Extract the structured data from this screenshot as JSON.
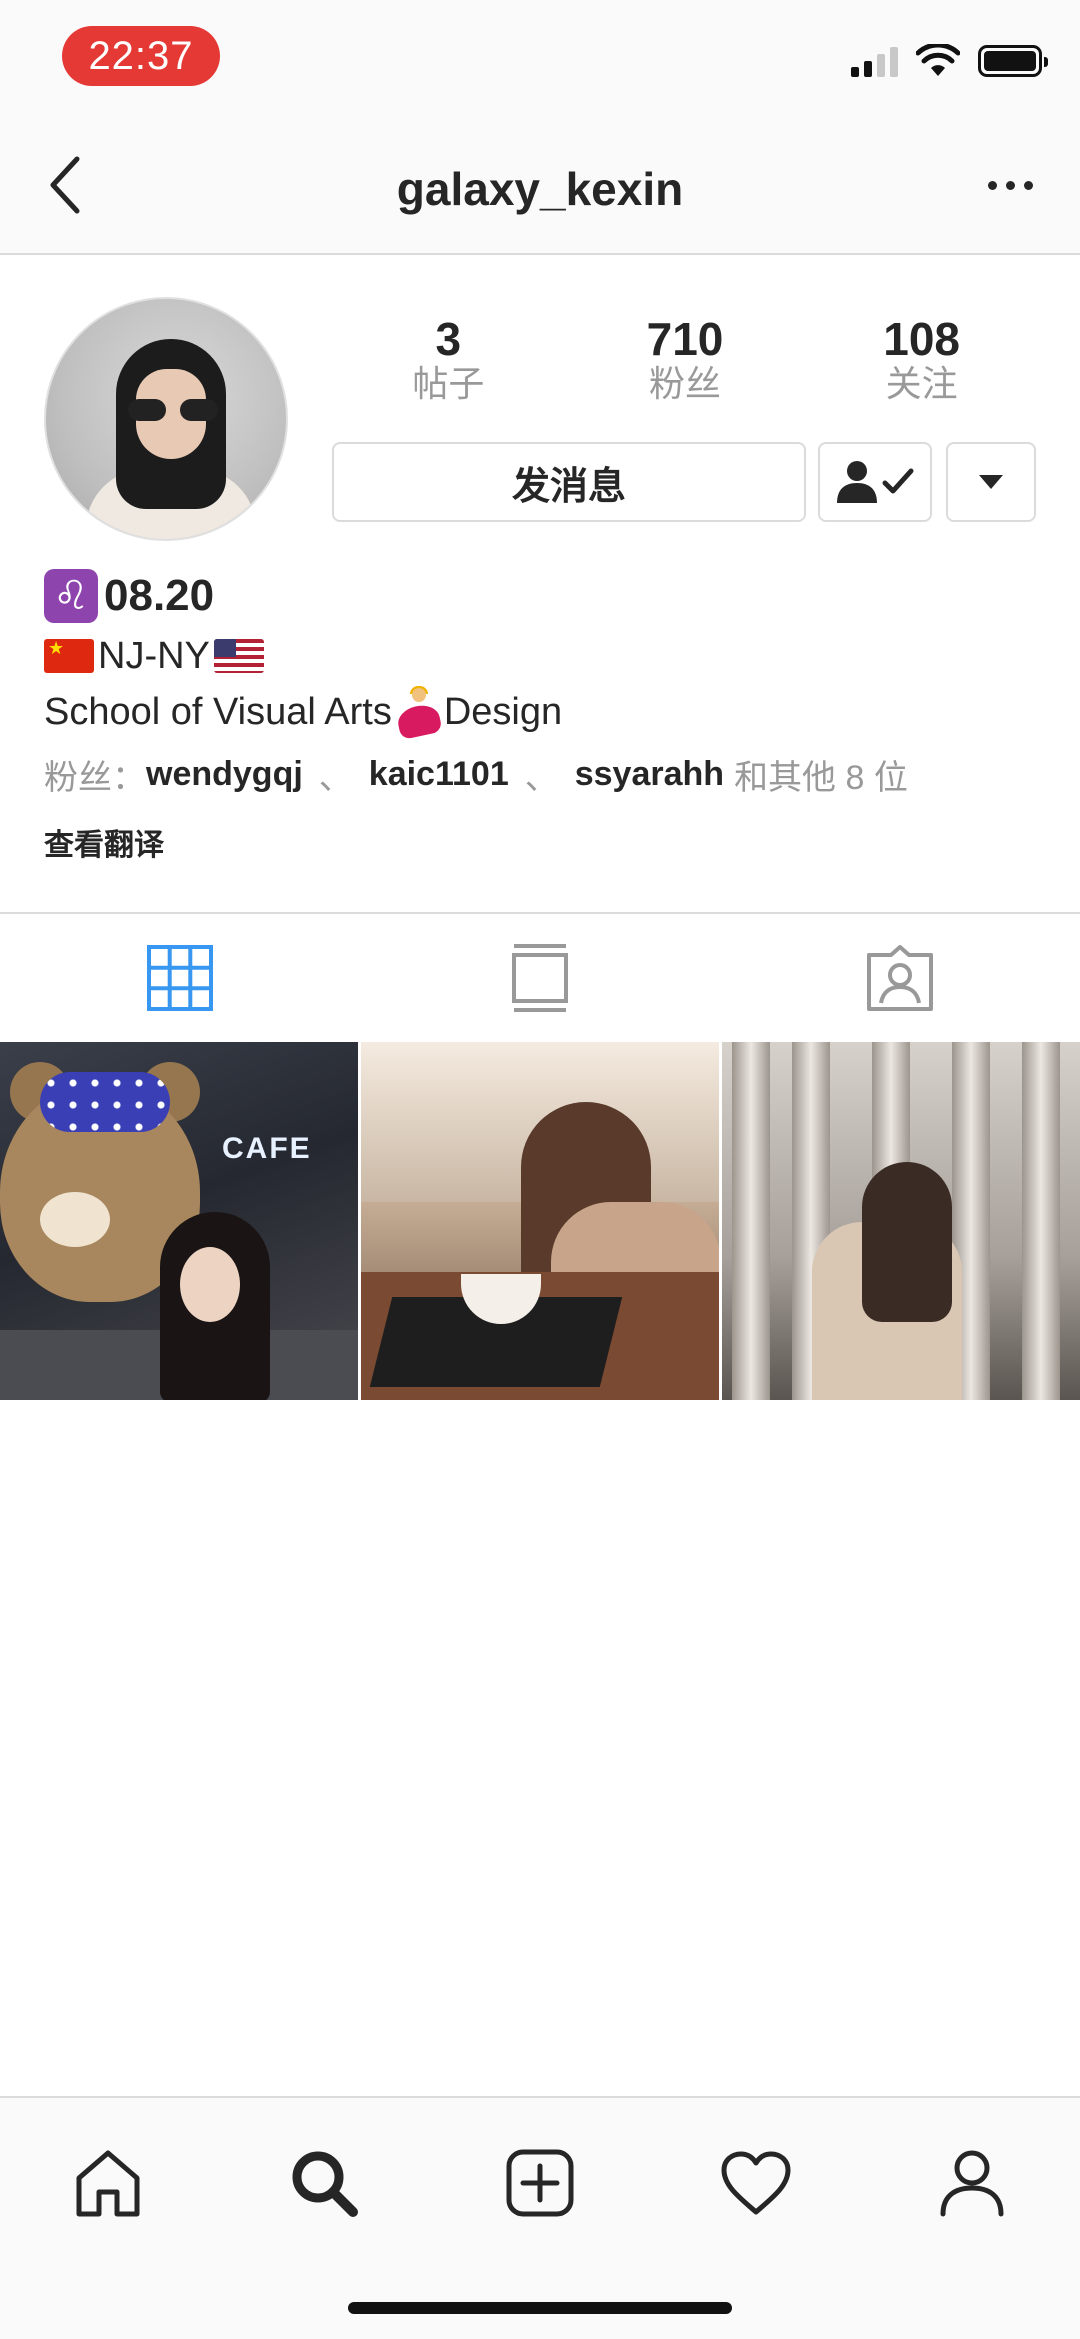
{
  "status_bar": {
    "time": "22:37"
  },
  "header": {
    "username": "galaxy_kexin"
  },
  "profile": {
    "stats": [
      {
        "value": "3",
        "label": "帖子"
      },
      {
        "value": "710",
        "label": "粉丝"
      },
      {
        "value": "108",
        "label": "关注"
      }
    ],
    "message_button": "发消息"
  },
  "bio": {
    "line1_text": "08.20",
    "line2_text": "NJ-NY",
    "line3_before": "School of Visual Arts",
    "line3_after": "Design",
    "followers_prefix": "粉丝：",
    "followers": [
      "wendygqj",
      "kaic1101",
      "ssyarahh"
    ],
    "followers_separator": "、",
    "followers_suffix": "和其他 8 位",
    "translate": "查看翻译"
  },
  "tabs": [
    {
      "icon": "grid-icon",
      "active": true
    },
    {
      "icon": "feed-icon",
      "active": false
    },
    {
      "icon": "tagged-icon",
      "active": false
    }
  ],
  "colors": {
    "active_tab": "#3897f0",
    "inactive_icon": "#999999",
    "time_pill": "#e53935"
  },
  "bottom_nav": [
    "home-icon",
    "search-icon",
    "new-post-icon",
    "activity-heart-icon",
    "profile-icon"
  ]
}
